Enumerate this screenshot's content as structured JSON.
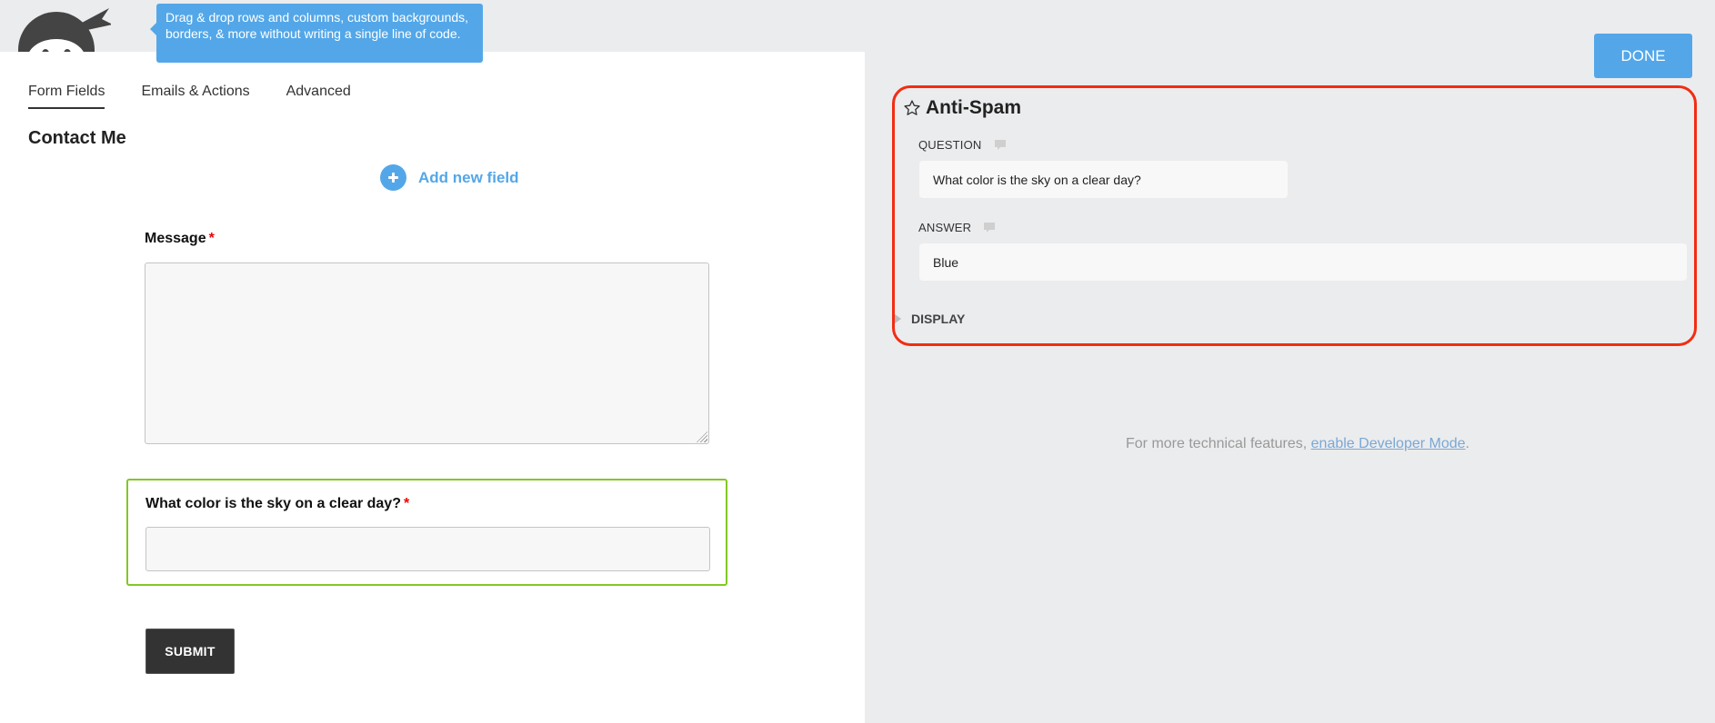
{
  "tooltip": {
    "text": "Drag & drop rows and columns, custom backgrounds, borders, & more without writing a single line of code."
  },
  "tabs": [
    {
      "label": "Form Fields",
      "active": true
    },
    {
      "label": "Emails & Actions",
      "active": false
    },
    {
      "label": "Advanced",
      "active": false
    }
  ],
  "form": {
    "title": "Contact Me",
    "add_field_label": "Add new field",
    "fields": [
      {
        "label": "Message",
        "required_mark": "*",
        "type": "textarea",
        "value": ""
      },
      {
        "label": "What color is the sky on a clear day?",
        "required_mark": "*",
        "type": "text",
        "value": ""
      }
    ],
    "submit_label": "SUBMIT"
  },
  "header": {
    "done_label": "DONE"
  },
  "settings": {
    "title": "Anti-Spam",
    "question_label": "QUESTION",
    "question_value": "What color is the sky on a clear day?",
    "answer_label": "ANSWER",
    "answer_value": "Blue",
    "display_label": "DISPLAY"
  },
  "footer_note": {
    "prefix": "For more technical features, ",
    "link_text": "enable Developer Mode",
    "suffix": "."
  },
  "colors": {
    "accent": "#53a7e8",
    "highlight_red": "#f22d12",
    "active_field_green": "#82c726",
    "required": "#e00000"
  }
}
